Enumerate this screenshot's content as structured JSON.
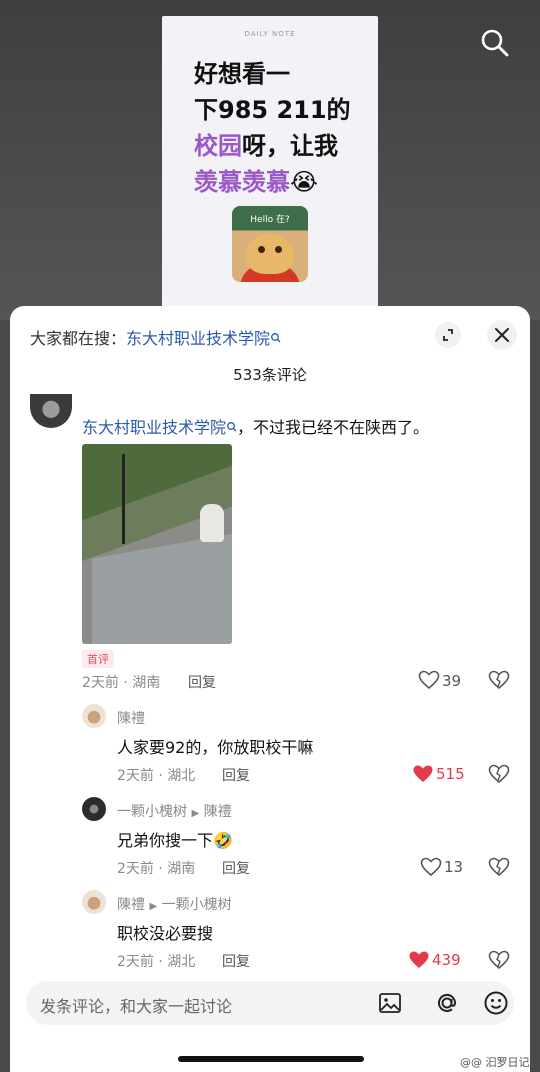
{
  "video": {
    "note_tag": "DAILY NOTE",
    "note_line1": "好想看一",
    "note_line2": "下985 211的",
    "note_line3_highlight": "校园",
    "note_line3_rest": "呀，让我",
    "note_line4_highlight": "羡慕羡慕",
    "note_emoji": "😭",
    "hello_label": "Hello 在?"
  },
  "sheet": {
    "suggest_prefix": "大家都在搜：",
    "suggest_keyword": "东大村职业技术学院",
    "comment_count": "533条评论"
  },
  "comments": [
    {
      "kw": "东大村职业技术学院",
      "text": "，不过我已经不在陕西了。",
      "badge": "首评",
      "meta": "2天前 · 湖南",
      "reply": "回复",
      "likes": "39"
    }
  ],
  "replies": [
    {
      "name": "陳禮",
      "to": "",
      "text": "人家要92的，你放职校干嘛",
      "meta": "2天前 · 湖北",
      "reply": "回复",
      "likes": "515",
      "liked": true
    },
    {
      "name": "一颗小槐树",
      "to": "陳禮",
      "text": "兄弟你搜一下",
      "emoji": "🤣",
      "meta": "2天前 · 湖南",
      "reply": "回复",
      "likes": "13",
      "liked": false
    },
    {
      "name": "陳禮",
      "to": "一颗小槐树",
      "text": "职校没必要搜",
      "meta": "2天前 · 湖北",
      "reply": "回复",
      "likes": "439",
      "liked": true
    }
  ],
  "input": {
    "placeholder": "发条评论，和大家一起讨论"
  },
  "watermark": "@@ 汩罗日记",
  "colors": {
    "link": "#2b5aa8",
    "liked": "#e33a4c",
    "highlight": "#9b59c7"
  }
}
